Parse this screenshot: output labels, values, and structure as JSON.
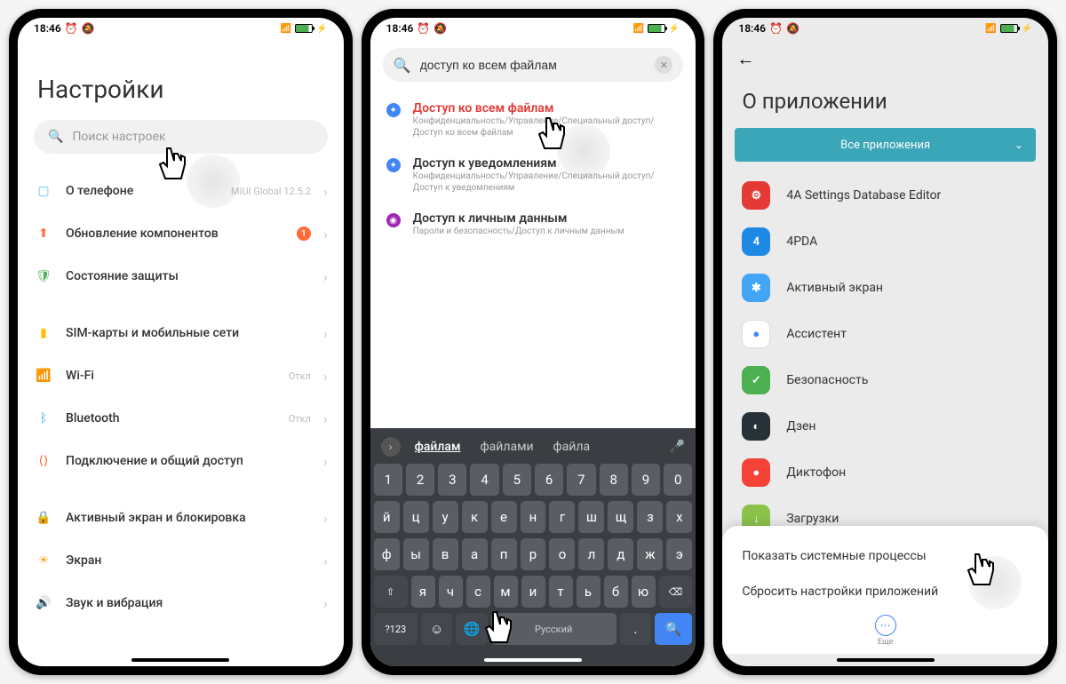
{
  "status": {
    "time": "18:46",
    "network": "46",
    "battery_label": "82"
  },
  "phone1": {
    "title": "Настройки",
    "search_placeholder": "Поиск настроек",
    "items": [
      {
        "icon": "phone-icon",
        "color": "#4fc3f7",
        "label": "О телефоне",
        "tail": "MIUI Global 12.5.2"
      },
      {
        "icon": "arrow-up-icon",
        "color": "#ff7043",
        "label": "Обновление компонентов",
        "badge": "1"
      },
      {
        "icon": "shield-icon",
        "color": "#4caf50",
        "label": "Состояние защиты"
      }
    ],
    "items2": [
      {
        "icon": "sim-icon",
        "color": "#ffc107",
        "label": "SIM-карты и мобильные сети"
      },
      {
        "icon": "wifi-icon",
        "color": "#29b6f6",
        "label": "Wi-Fi",
        "tail": "Откл"
      },
      {
        "icon": "bluetooth-icon",
        "color": "#42a5f5",
        "label": "Bluetooth",
        "tail": "Откл"
      },
      {
        "icon": "share-icon",
        "color": "#ff5722",
        "label": "Подключение и общий доступ"
      }
    ],
    "items3": [
      {
        "icon": "lock-icon",
        "color": "#ef5350",
        "label": "Активный экран и блокировка"
      },
      {
        "icon": "brightness-icon",
        "color": "#ffa726",
        "label": "Экран"
      },
      {
        "icon": "sound-icon",
        "color": "#66bb6a",
        "label": "Звук и вибрация"
      }
    ]
  },
  "phone2": {
    "search_value": "доступ ко всем файлам",
    "results": [
      {
        "icon_bg": "#4285f4",
        "title": "Доступ ко всем файлам",
        "highlight": true,
        "sub": "Конфиденциальность/Управление/Специальный доступ/Доступ ко всем файлам"
      },
      {
        "icon_bg": "#4285f4",
        "title": "Доступ к уведомлениям",
        "sub": "Конфиденциальность/Управление/Специальный доступ/Доступ к уведомлениям"
      },
      {
        "icon_bg": "#9c27b0",
        "title": "Доступ к личным данным",
        "sub": "Пароли и безопасность/Доступ к личным данным"
      }
    ],
    "suggestions": {
      "primary": "файлам",
      "others": [
        "файлами",
        "файла"
      ]
    },
    "keyboard": {
      "row_num": [
        "1",
        "2",
        "3",
        "4",
        "5",
        "6",
        "7",
        "8",
        "9",
        "0"
      ],
      "row1": [
        "й",
        "ц",
        "у",
        "к",
        "е",
        "н",
        "г",
        "ш",
        "щ",
        "з",
        "х"
      ],
      "row2": [
        "ф",
        "ы",
        "в",
        "а",
        "п",
        "р",
        "о",
        "л",
        "д",
        "ж",
        "э"
      ],
      "row3_shift": "⇧",
      "row3": [
        "я",
        "ч",
        "с",
        "м",
        "и",
        "т",
        "ь",
        "б",
        "ю"
      ],
      "row3_bksp": "⌫",
      "row4_sym": "?123",
      "row4_lang": "Русский",
      "row4_search": "🔍"
    }
  },
  "phone3": {
    "title": "О приложении",
    "filter": "Все приложения",
    "apps": [
      {
        "bg": "#e53935",
        "glyph": "⚙",
        "label": "4A Settings Database Editor"
      },
      {
        "bg": "#1e88e5",
        "glyph": "4",
        "label": "4PDA"
      },
      {
        "bg": "#42a5f5",
        "glyph": "✱",
        "label": "Активный экран"
      },
      {
        "bg": "#ffffff",
        "glyph": "●",
        "label": "Ассистент",
        "glyph_color": "#4285f4"
      },
      {
        "bg": "#4caf50",
        "glyph": "✓",
        "label": "Безопасность"
      },
      {
        "bg": "#263238",
        "glyph": "◐",
        "label": "Дзен"
      },
      {
        "bg": "#f44336",
        "glyph": "●",
        "label": "Диктофон"
      },
      {
        "bg": "#8bc34a",
        "glyph": "↓",
        "label": "Загрузки"
      }
    ],
    "sheet": {
      "opt1": "Показать системные процессы",
      "opt2": "Сбросить настройки приложений",
      "more": "Еще"
    }
  }
}
